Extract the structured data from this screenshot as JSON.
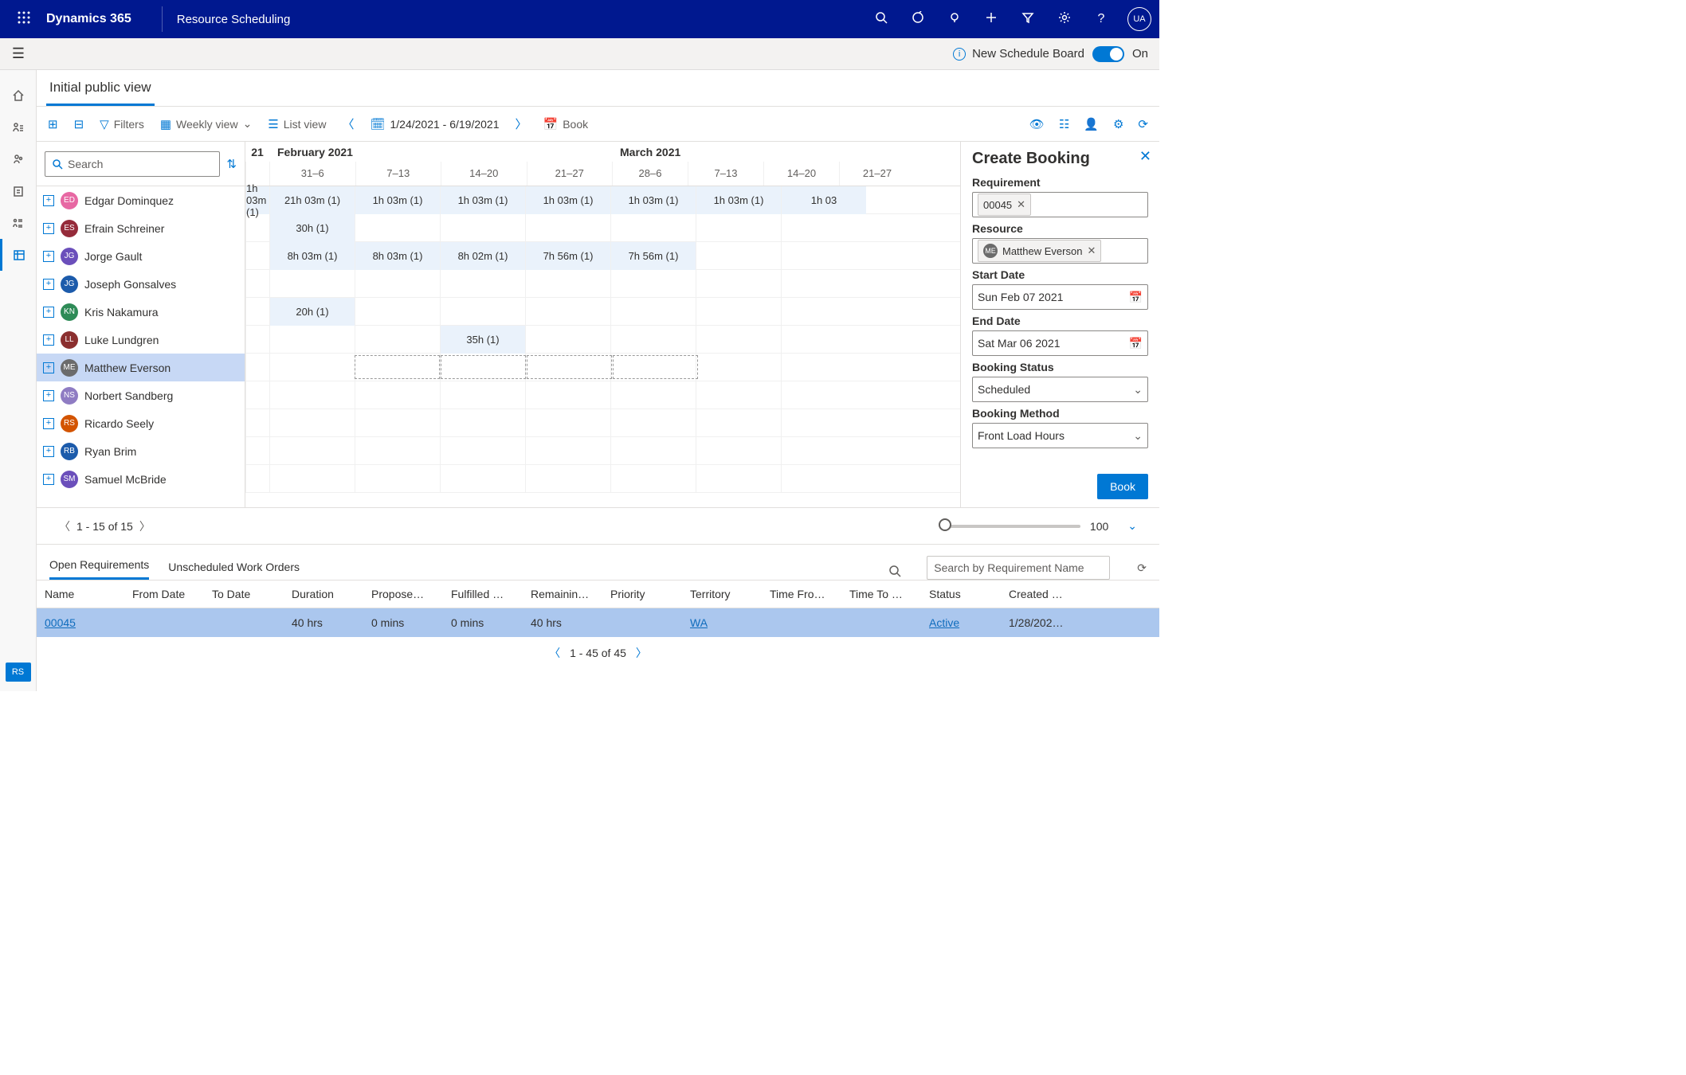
{
  "header": {
    "brand": "Dynamics 365",
    "module": "Resource Scheduling",
    "avatar": "UA"
  },
  "subheader": {
    "label": "New Schedule Board",
    "state": "On"
  },
  "tab": {
    "label": "Initial public view"
  },
  "toolbar": {
    "filters": "Filters",
    "view_mode": "Weekly view",
    "list_view": "List view",
    "range": "1/24/2021 - 6/19/2021",
    "book": "Book"
  },
  "search_placeholder": "Search",
  "year_stub": "21",
  "months": [
    {
      "label": "February 2021",
      "weeks": [
        "31–6",
        "7–13",
        "14–20",
        "21–27"
      ]
    },
    {
      "label": "March 2021",
      "weeks": [
        "28–6",
        "7–13",
        "14–20",
        "21–27"
      ]
    }
  ],
  "resources": [
    {
      "initials": "ED",
      "color": "#E768A3",
      "name": "Edgar Dominquez",
      "cells": [
        "1h 03m (1)",
        "21h 03m (1)",
        "1h 03m (1)",
        "1h 03m (1)",
        "1h 03m (1)",
        "1h 03m (1)",
        "1h 03m (1)",
        "1h 03"
      ]
    },
    {
      "initials": "ES",
      "color": "#952B3A",
      "name": "Efrain Schreiner",
      "cells": [
        "",
        "30h (1)",
        "",
        "",
        "",
        "",
        "",
        ""
      ]
    },
    {
      "initials": "JG",
      "color": "#6B4FBB",
      "name": "Jorge Gault",
      "cells": [
        "",
        "8h 03m (1)",
        "8h 03m (1)",
        "8h 02m (1)",
        "7h 56m (1)",
        "7h 56m (1)",
        "",
        ""
      ]
    },
    {
      "initials": "JG",
      "color": "#1C5BAB",
      "name": "Joseph Gonsalves",
      "cells": [
        "",
        "",
        "",
        "",
        "",
        "",
        "",
        ""
      ]
    },
    {
      "initials": "KN",
      "color": "#2E8B57",
      "name": "Kris Nakamura",
      "cells": [
        "",
        "20h (1)",
        "",
        "",
        "",
        "",
        "",
        ""
      ]
    },
    {
      "initials": "LL",
      "color": "#8B2F2F",
      "name": "Luke Lundgren",
      "cells": [
        "",
        "",
        "",
        "35h (1)",
        "",
        "",
        "",
        ""
      ]
    },
    {
      "initials": "ME",
      "color": "#6B6B6B",
      "name": "Matthew Everson",
      "cells": [
        "",
        "",
        "",
        "",
        "",
        "",
        "",
        ""
      ],
      "selected": true
    },
    {
      "initials": "NS",
      "color": "#8F7CC3",
      "name": "Norbert Sandberg",
      "cells": [
        "",
        "",
        "",
        "",
        "",
        "",
        "",
        ""
      ]
    },
    {
      "initials": "RS",
      "color": "#D35400",
      "name": "Ricardo Seely",
      "cells": [
        "",
        "",
        "",
        "",
        "",
        "",
        "",
        ""
      ]
    },
    {
      "initials": "RB",
      "color": "#1C5BAB",
      "name": "Ryan Brim",
      "cells": [
        "",
        "",
        "",
        "",
        "",
        "",
        "",
        ""
      ]
    },
    {
      "initials": "SM",
      "color": "#6B4FBB",
      "name": "Samuel McBride",
      "cells": [
        "",
        "",
        "",
        "",
        "",
        "",
        "",
        ""
      ]
    }
  ],
  "panel": {
    "title": "Create Booking",
    "requirement_label": "Requirement",
    "requirement_value": "00045",
    "resource_label": "Resource",
    "resource_value": "Matthew Everson",
    "resource_initials": "ME",
    "start_label": "Start Date",
    "start_value": "Sun Feb 07 2021",
    "end_label": "End Date",
    "end_value": "Sat Mar 06 2021",
    "status_label": "Booking Status",
    "status_value": "Scheduled",
    "method_label": "Booking Method",
    "method_value": "Front Load Hours",
    "book_btn": "Book"
  },
  "pager": {
    "text": "1 - 15 of 15",
    "zoom": "100"
  },
  "bottom_tabs": {
    "t1": "Open Requirements",
    "t2": "Unscheduled Work Orders",
    "search_ph": "Search by Requirement Name"
  },
  "columns": [
    "Name",
    "From Date",
    "To Date",
    "Duration",
    "Propose…",
    "Fulfilled …",
    "Remainin…",
    "Priority",
    "Territory",
    "Time Fro…",
    "Time To …",
    "Status",
    "Created …"
  ],
  "row": {
    "name": "00045",
    "duration": "40 hrs",
    "proposed": "0 mins",
    "fulfilled": "0 mins",
    "remaining": "40 hrs",
    "territory": "WA",
    "status": "Active",
    "created": "1/28/202…"
  },
  "bottom_pager": "1 - 45 of 45",
  "leftcorner": "RS"
}
